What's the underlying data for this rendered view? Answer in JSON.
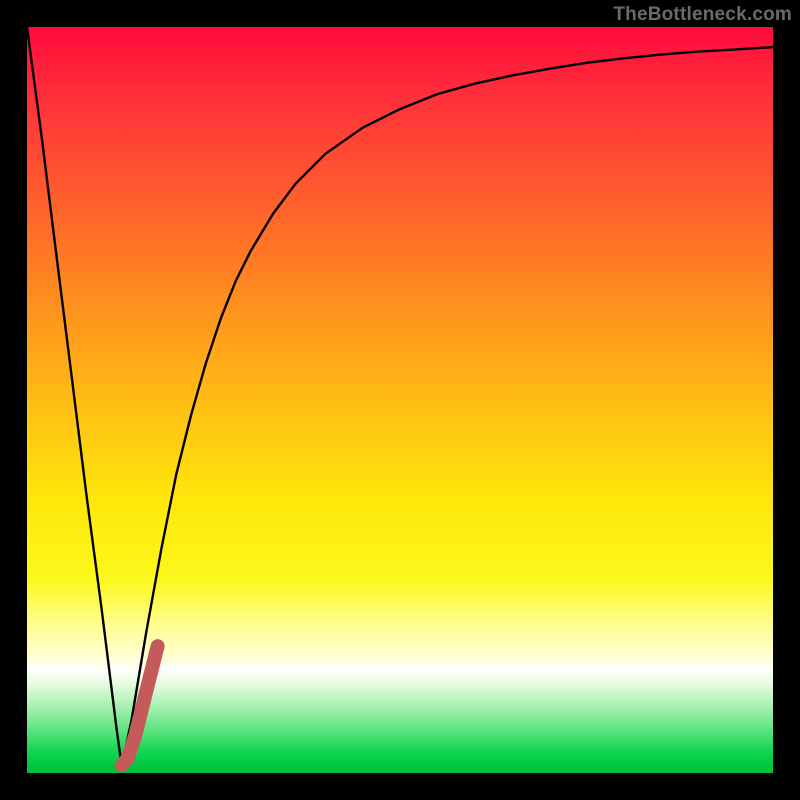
{
  "watermark": "TheBottleneck.com",
  "colors": {
    "frame_bg": "#000000",
    "curve_stroke": "#000000",
    "marker_stroke": "#c55a5a",
    "gradient_top": "#ff0a3a",
    "gradient_bottom": "#00c23c"
  },
  "chart_data": {
    "type": "line",
    "title": "",
    "xlabel": "",
    "ylabel": "",
    "xlim": [
      0,
      100
    ],
    "ylim": [
      0,
      100
    ],
    "grid": false,
    "legend": false,
    "series": [
      {
        "name": "bottleneck-curve",
        "x": [
          0,
          2,
          4,
          6,
          8,
          10,
          12,
          12.7,
          14,
          16,
          18,
          20,
          22,
          24,
          26,
          28,
          30,
          33,
          36,
          40,
          45,
          50,
          55,
          60,
          65,
          70,
          75,
          80,
          85,
          90,
          95,
          100
        ],
        "values": [
          100,
          85,
          69,
          53,
          37,
          22,
          6,
          1,
          7,
          19,
          30,
          40,
          48,
          55,
          61,
          66,
          70,
          75,
          79,
          83,
          86.5,
          89,
          91,
          92.4,
          93.5,
          94.4,
          95.2,
          95.8,
          96.3,
          96.7,
          97.0,
          97.3
        ]
      },
      {
        "name": "bottleneck-marker",
        "x": [
          12.7,
          13.5,
          14.5,
          15.5,
          16.5,
          17.5
        ],
        "values": [
          1,
          2,
          5,
          9,
          13,
          17
        ]
      }
    ],
    "annotations": []
  }
}
